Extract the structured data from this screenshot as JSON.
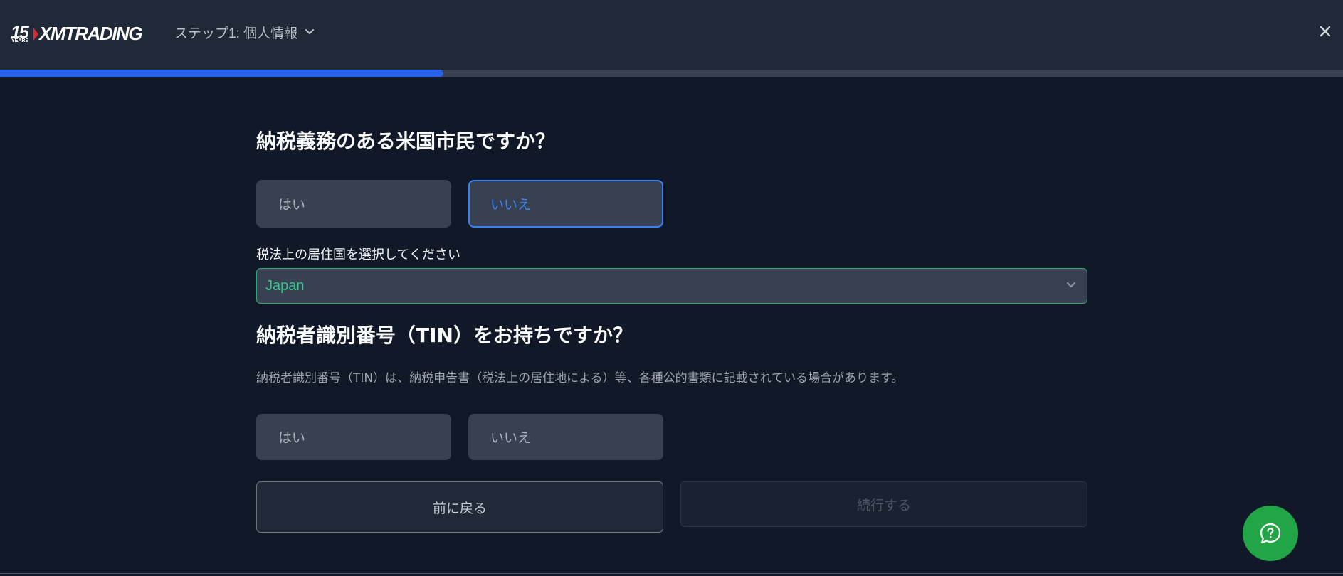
{
  "header": {
    "logo_years_number": "15",
    "logo_years_word": "YEARS",
    "logo_brand": "XMTRADING",
    "step_label": "ステップ1: 個人情報",
    "progress_fraction": 0.33
  },
  "question_us_citizen": {
    "title": "納税義務のある米国市民ですか？",
    "options": [
      {
        "label": "はい",
        "selected": false
      },
      {
        "label": "いいえ",
        "selected": true
      }
    ]
  },
  "tax_residence": {
    "label": "税法上の居住国を選択してください",
    "value": "Japan"
  },
  "question_tin": {
    "title": "納税者識別番号（TIN）をお持ちですか？",
    "description": "納税者識別番号（TIN）は、納税申告書（税法上の居住地による）等、各種公的書類に記載されている場合があります。",
    "options": [
      {
        "label": "はい",
        "selected": false
      },
      {
        "label": "いいえ",
        "selected": false
      }
    ]
  },
  "buttons": {
    "back_label": "前に戻る",
    "continue_label": "続行する"
  },
  "colors": {
    "background": "#111827",
    "header": "#1f2937",
    "accent_blue": "#3b82f6",
    "progress": "#2563eb",
    "select_accent": "#34c58c",
    "help_button": "#22a547"
  }
}
